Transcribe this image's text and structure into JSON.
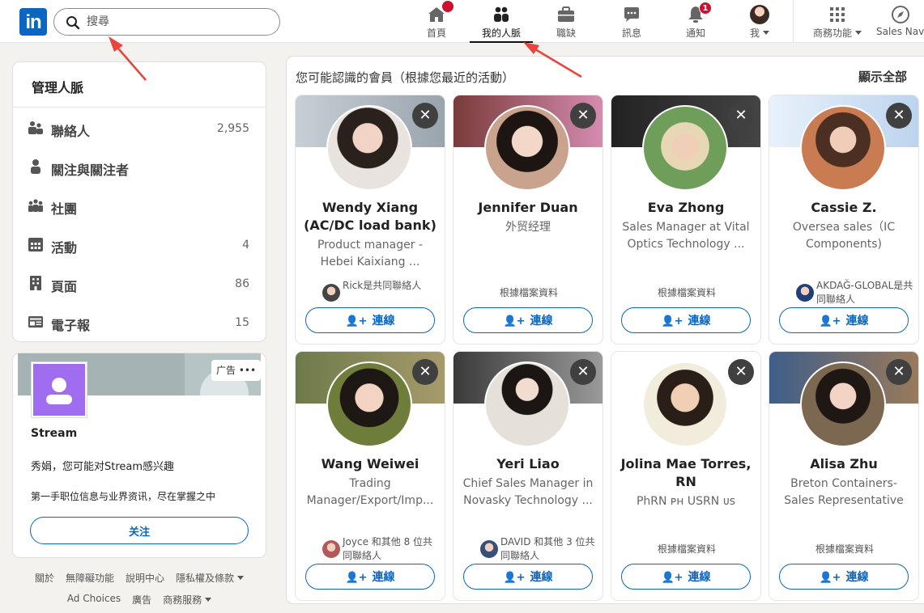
{
  "nav": {
    "logo": "in",
    "search_placeholder": "搜尋",
    "items": [
      {
        "label": "首頁",
        "badge": ""
      },
      {
        "label": "我的人脈",
        "badge": ""
      },
      {
        "label": "職缺",
        "badge": ""
      },
      {
        "label": "訊息",
        "badge": ""
      },
      {
        "label": "通知",
        "badge": "1"
      },
      {
        "label": "我",
        "badge": ""
      },
      {
        "label": "商務功能",
        "badge": ""
      },
      {
        "label": "Sales Nav",
        "badge": ""
      }
    ]
  },
  "manage": {
    "title": "管理人脈",
    "rows": [
      {
        "label": "聯絡人",
        "count": "2,955"
      },
      {
        "label": "關注與關注者",
        "count": ""
      },
      {
        "label": "社團",
        "count": ""
      },
      {
        "label": "活動",
        "count": "4"
      },
      {
        "label": "頁面",
        "count": "86"
      },
      {
        "label": "電子報",
        "count": "15"
      }
    ]
  },
  "ad": {
    "tag": "广告 •••",
    "company": "Stream",
    "line1": "秀娟，您可能对Stream感兴趣",
    "line2": "第一手职位信息与业界资讯，尽在掌握之中",
    "follow": "关注"
  },
  "footer": {
    "row1": [
      "關於",
      "無障礙功能",
      "說明中心",
      "隱私權及條款"
    ],
    "row2": [
      "Ad Choices",
      "廣告",
      "商務服務"
    ]
  },
  "main": {
    "heading": "您可能認識的會員（根據您最近的活動）",
    "show_all": "顯示全部",
    "connect_label": "連線",
    "people": [
      {
        "name": "Wendy Xiang (AC/DC load bank)",
        "headline": "Product manager - Hebei Kaixiang ...",
        "mutual": "Rick是共同聯絡人"
      },
      {
        "name": "Jennifer Duan",
        "headline": "外贸经理",
        "mutual": "根據檔案資料"
      },
      {
        "name": "Eva Zhong",
        "headline": "Sales Manager at Vital Optics Technology ...",
        "mutual": "根據檔案資料"
      },
      {
        "name": "Cassie Z.",
        "headline": "Oversea sales（IC Components)",
        "mutual": "AKDAĞ-GLOBAL是共同聯絡人"
      },
      {
        "name": "Wang Weiwei",
        "headline": "Trading Manager/Export/Imp...",
        "mutual": "Joyce 和其他 8 位共同聯絡人"
      },
      {
        "name": "Yeri Liao",
        "headline": "Chief Sales Manager in Novasky Technology ...",
        "mutual": "DAVID 和其他 3 位共同聯絡人"
      },
      {
        "name": "Jolina Mae Torres, RN",
        "headline": "PhRN ᴘʜ USRN ᴜs",
        "mutual": "根據檔案資料"
      },
      {
        "name": "Alisa Zhu",
        "headline": "Breton Containers-Sales Representative",
        "mutual": "根據檔案資料"
      }
    ]
  }
}
